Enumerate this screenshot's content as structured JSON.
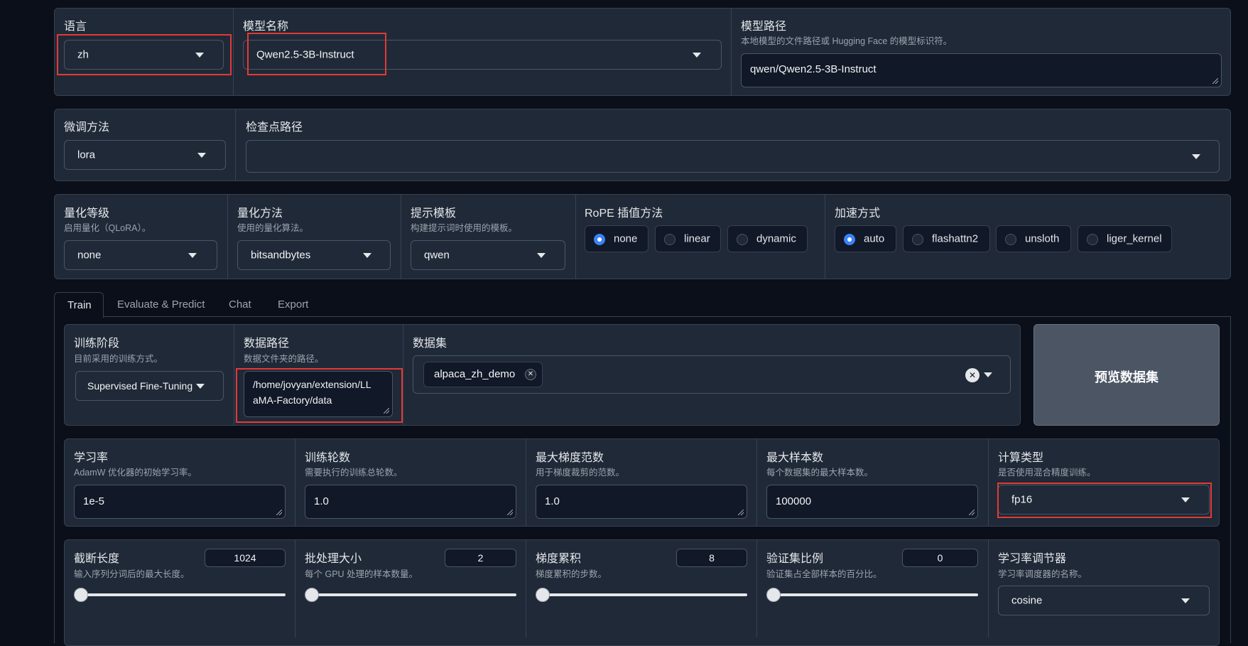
{
  "top_row": {
    "language": {
      "label": "语言",
      "value": "zh"
    },
    "model_name": {
      "label": "模型名称",
      "value": "Qwen2.5-3B-Instruct"
    },
    "model_path": {
      "label": "模型路径",
      "info": "本地模型的文件路径或 Hugging Face 的模型标识符。",
      "value": "qwen/Qwen2.5-3B-Instruct"
    }
  },
  "finetune_row": {
    "method": {
      "label": "微调方法",
      "value": "lora"
    },
    "checkpoint": {
      "label": "检查点路径",
      "value": ""
    }
  },
  "advanced_row": {
    "quant_bit": {
      "label": "量化等级",
      "info": "启用量化（QLoRA）。",
      "value": "none"
    },
    "quant_method": {
      "label": "量化方法",
      "info": "使用的量化算法。",
      "value": "bitsandbytes"
    },
    "template": {
      "label": "提示模板",
      "info": "构建提示词时使用的模板。",
      "value": "qwen"
    },
    "rope": {
      "label": "RoPE 插值方法",
      "options": [
        "none",
        "linear",
        "dynamic"
      ],
      "selected": "none"
    },
    "booster": {
      "label": "加速方式",
      "options": [
        "auto",
        "flashattn2",
        "unsloth",
        "liger_kernel"
      ],
      "selected": "auto"
    }
  },
  "tabs": [
    "Train",
    "Evaluate & Predict",
    "Chat",
    "Export"
  ],
  "active_tab": "Train",
  "train": {
    "stage": {
      "label": "训练阶段",
      "info": "目前采用的训练方式。",
      "value": "Supervised Fine-Tuning"
    },
    "dataset_dir": {
      "label": "数据路径",
      "info": "数据文件夹的路径。",
      "value_line1": "/home/jovyan/extension/LL",
      "value_line2": "aMA-Factory/data"
    },
    "dataset": {
      "label": "数据集",
      "chips": [
        "alpaca_zh_demo"
      ]
    },
    "preview_button": "预览数据集",
    "learning_rate": {
      "label": "学习率",
      "info": "AdamW 优化器的初始学习率。",
      "value": "1e-5"
    },
    "epochs": {
      "label": "训练轮数",
      "info": "需要执行的训练总轮数。",
      "value": "1.0"
    },
    "max_grad_norm": {
      "label": "最大梯度范数",
      "info": "用于梯度裁剪的范数。",
      "value": "1.0"
    },
    "max_samples": {
      "label": "最大样本数",
      "info": "每个数据集的最大样本数。",
      "value": "100000"
    },
    "compute_type": {
      "label": "计算类型",
      "info": "是否使用混合精度训练。",
      "value": "fp16"
    },
    "cutoff_len": {
      "label": "截断长度",
      "info": "输入序列分词后的最大长度。",
      "value": "1024",
      "slider_fraction": 0.0
    },
    "batch_size": {
      "label": "批处理大小",
      "info": "每个 GPU 处理的样本数量。",
      "value": "2",
      "slider_fraction": 0.0
    },
    "grad_accum": {
      "label": "梯度累积",
      "info": "梯度累积的步数。",
      "value": "8",
      "slider_fraction": 0.0
    },
    "val_size": {
      "label": "验证集比例",
      "info": "验证集占全部样本的百分比。",
      "value": "0",
      "slider_fraction": 0.0
    },
    "lr_scheduler": {
      "label": "学习率调节器",
      "info": "学习率调度器的名称。",
      "value": "cosine"
    }
  },
  "colors": {
    "background": "#0b0f19",
    "panel": "#1f2937",
    "border": "#374151",
    "accent": "#3b82f6",
    "highlight": "#e53935"
  }
}
